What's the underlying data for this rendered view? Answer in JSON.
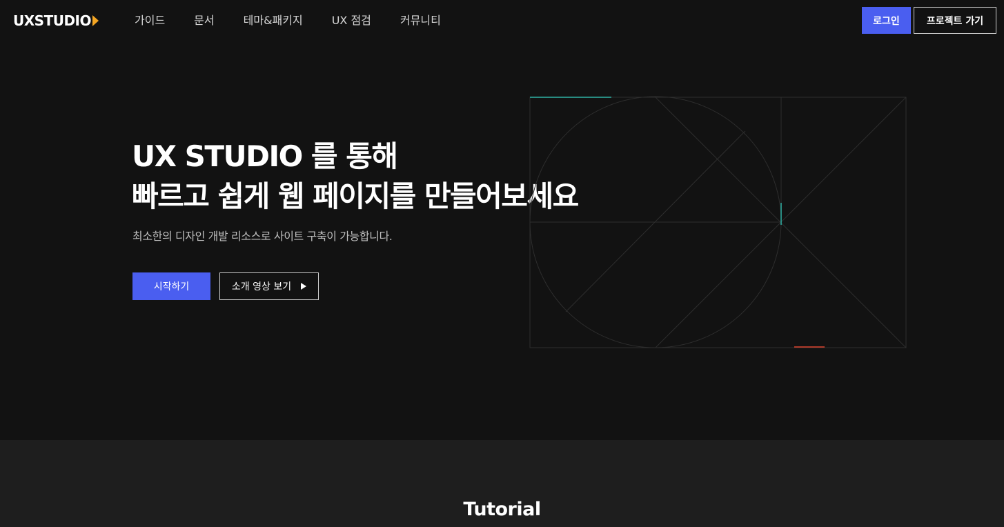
{
  "header": {
    "logo_text": "UXSTUDIO",
    "nav": [
      "가이드",
      "문서",
      "테마&패키지",
      "UX 점검",
      "커뮤니티"
    ],
    "login_label": "로그인",
    "project_label": "프로젝트 가기"
  },
  "hero": {
    "title_line1": "UX STUDIO 를 통해",
    "title_line2": "빠르고 쉽게 웹 페이지를 만들어보세요",
    "subtitle": "최소한의 디자인 개발 리소스로 사이트 구축이 가능합니다.",
    "start_label": "시작하기",
    "video_label": "소개 영상 보기"
  },
  "tutorial": {
    "title": "Tutorial"
  },
  "colors": {
    "background": "#121212",
    "section_bg": "#1e1e1e",
    "accent": "#4a5ef0",
    "logo_mark": "#f5a623",
    "graphic_line": "#2e2e2e",
    "graphic_teal": "#2fb3a6",
    "graphic_red": "#e0452f"
  },
  "icons": {
    "logo_mark": "chevron-right-icon",
    "video_play": "play-icon"
  }
}
